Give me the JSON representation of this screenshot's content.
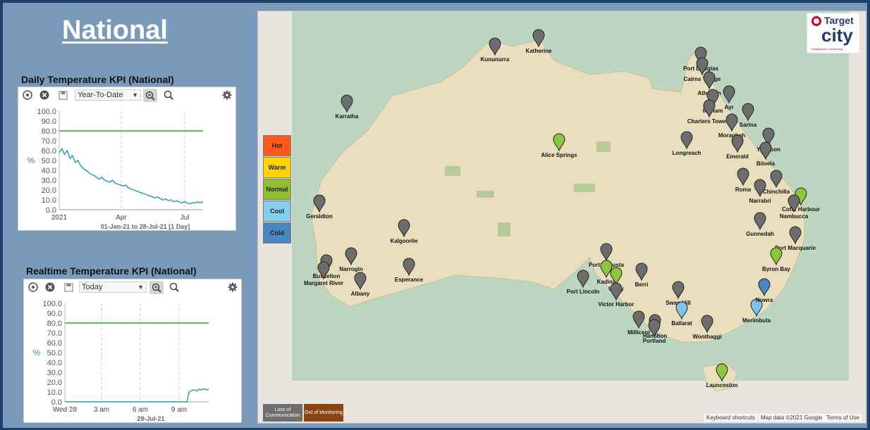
{
  "page": {
    "title": "National"
  },
  "daily_panel": {
    "title": "Daily Temperature KPI (National)",
    "range_select": "Year-To-Date",
    "footer": "01-Jan-21 to 28-Jul-21   [1 Day]",
    "icons": [
      "add-icon",
      "remove-icon",
      "save-icon",
      "zoom-in-active-icon",
      "zoom-icon",
      "settings-icon"
    ]
  },
  "realtime_panel": {
    "title": "Realtime Temperature KPI (National)",
    "range_select": "Today",
    "footer": "28-Jul-21"
  },
  "chart_data": [
    {
      "type": "line",
      "ylabel": "%",
      "ylim": [
        0,
        100
      ],
      "y_ticks": [
        "0.0",
        "10.0",
        "20.0",
        "30.0",
        "40.0",
        "50.0",
        "60.0",
        "70.0",
        "80.0",
        "90.0",
        "100.0"
      ],
      "x_ticks": [
        "2021",
        "Apr",
        "Jul"
      ],
      "target_line": 80,
      "series": [
        {
          "values": [
            58,
            62,
            56,
            60,
            52,
            55,
            48,
            50,
            45,
            42,
            40,
            38,
            36,
            35,
            33,
            31,
            33,
            30,
            29,
            28,
            30,
            27,
            26,
            25,
            24,
            25,
            22,
            21,
            20,
            19,
            18,
            17,
            16,
            15,
            14,
            13,
            12,
            13,
            11,
            10,
            11,
            9,
            10,
            8,
            9,
            8,
            7,
            8,
            7,
            6,
            7,
            7,
            8,
            7,
            8
          ]
        }
      ]
    },
    {
      "type": "line",
      "ylabel": "%",
      "ylim": [
        0,
        100
      ],
      "y_ticks": [
        "0.0",
        "10.0",
        "20.0",
        "30.0",
        "40.0",
        "50.0",
        "60.0",
        "70.0",
        "80.0",
        "90.0",
        "100.0"
      ],
      "x_ticks": [
        "Wed 28",
        "3 am",
        "6 am",
        "9 am"
      ],
      "target_line": 80,
      "series": [
        {
          "values": [
            0,
            0,
            0,
            0,
            0,
            0,
            0,
            0,
            0,
            0,
            0,
            0,
            0,
            0,
            0,
            0,
            0,
            0,
            0,
            0,
            0,
            0,
            0,
            0,
            0,
            0,
            0,
            0,
            0,
            0,
            0,
            0,
            0,
            0,
            0,
            0,
            0,
            0,
            0,
            0,
            0,
            0,
            0,
            0,
            0,
            0,
            0,
            0,
            0,
            0,
            0,
            0,
            0,
            0,
            0,
            0,
            0,
            0,
            0,
            0,
            0,
            0,
            0,
            10,
            11,
            12,
            12,
            11,
            13,
            12,
            13,
            13,
            12,
            13
          ]
        }
      ]
    }
  ],
  "map": {
    "legend": [
      {
        "label": "Hot",
        "color": "#ff5a1a"
      },
      {
        "label": "Warm",
        "color": "#ffd400"
      },
      {
        "label": "Normal",
        "color": "#8fbe2e"
      },
      {
        "label": "Cool",
        "color": "#87cdee"
      },
      {
        "label": "Cold",
        "color": "#4a86c2"
      }
    ],
    "footer_buttons": [
      {
        "label": "Loss of Communication",
        "color": "#6e6e6e"
      },
      {
        "label": "Out of Monitoring",
        "color": "#8b4513"
      }
    ],
    "credits": [
      "Keyboard shortcuts",
      "Map data ©2021 Google",
      "Terms of Use"
    ],
    "logo": {
      "line1": "Target",
      "line2": "city",
      "tagline": "Intelligence in Monitoring"
    },
    "places": [
      "Katherine",
      "Kununurra",
      "Karratha",
      "Port Douglas",
      "Cairns Village",
      "Atherton",
      "Ingham",
      "Ayr",
      "Charters Towers",
      "Sarina",
      "Moranbah",
      "Yeppoon",
      "Emerald",
      "Biloela",
      "Longreach",
      "Alice Springs",
      "Roma",
      "Chinchilla",
      "Narrabri",
      "Gunnedah",
      "Port Macquarie",
      "Geraldton",
      "Kalgoorlie",
      "Esperance",
      "Narrogin",
      "Busselton",
      "Margaret River",
      "Albany",
      "Port Augusta",
      "Port Lincoln",
      "Kadina",
      "Unley",
      "Victor Harbor",
      "Berri",
      "Swan Hill",
      "Ballarat",
      "Millicent",
      "Hamilton",
      "Portland",
      "Wonthaggi",
      "Merimbula",
      "Nowra",
      "Launceston",
      "Coffs Harbour",
      "Byron Bay",
      "Nambucca"
    ]
  }
}
